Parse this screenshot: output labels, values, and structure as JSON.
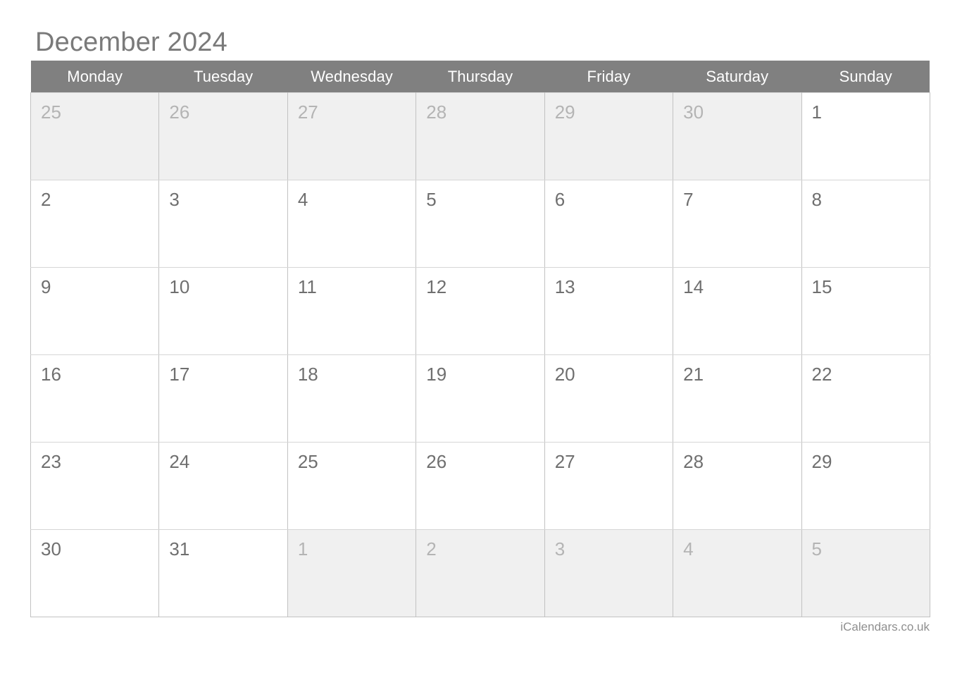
{
  "calendar": {
    "title": "December 2024",
    "month_name": "December",
    "year": "2024",
    "weekday_headers": [
      "Monday",
      "Tuesday",
      "Wednesday",
      "Thursday",
      "Friday",
      "Saturday",
      "Sunday"
    ],
    "weeks": [
      [
        {
          "day": "25",
          "in_month": false
        },
        {
          "day": "26",
          "in_month": false
        },
        {
          "day": "27",
          "in_month": false
        },
        {
          "day": "28",
          "in_month": false
        },
        {
          "day": "29",
          "in_month": false
        },
        {
          "day": "30",
          "in_month": false
        },
        {
          "day": "1",
          "in_month": true
        }
      ],
      [
        {
          "day": "2",
          "in_month": true
        },
        {
          "day": "3",
          "in_month": true
        },
        {
          "day": "4",
          "in_month": true
        },
        {
          "day": "5",
          "in_month": true
        },
        {
          "day": "6",
          "in_month": true
        },
        {
          "day": "7",
          "in_month": true
        },
        {
          "day": "8",
          "in_month": true
        }
      ],
      [
        {
          "day": "9",
          "in_month": true
        },
        {
          "day": "10",
          "in_month": true
        },
        {
          "day": "11",
          "in_month": true
        },
        {
          "day": "12",
          "in_month": true
        },
        {
          "day": "13",
          "in_month": true
        },
        {
          "day": "14",
          "in_month": true
        },
        {
          "day": "15",
          "in_month": true
        }
      ],
      [
        {
          "day": "16",
          "in_month": true
        },
        {
          "day": "17",
          "in_month": true
        },
        {
          "day": "18",
          "in_month": true
        },
        {
          "day": "19",
          "in_month": true
        },
        {
          "day": "20",
          "in_month": true
        },
        {
          "day": "21",
          "in_month": true
        },
        {
          "day": "22",
          "in_month": true
        }
      ],
      [
        {
          "day": "23",
          "in_month": true
        },
        {
          "day": "24",
          "in_month": true
        },
        {
          "day": "25",
          "in_month": true
        },
        {
          "day": "26",
          "in_month": true
        },
        {
          "day": "27",
          "in_month": true
        },
        {
          "day": "28",
          "in_month": true
        },
        {
          "day": "29",
          "in_month": true
        }
      ],
      [
        {
          "day": "30",
          "in_month": true
        },
        {
          "day": "31",
          "in_month": true
        },
        {
          "day": "1",
          "in_month": false
        },
        {
          "day": "2",
          "in_month": false
        },
        {
          "day": "3",
          "in_month": false
        },
        {
          "day": "4",
          "in_month": false
        },
        {
          "day": "5",
          "in_month": false
        }
      ]
    ]
  },
  "footer": {
    "credit": "iCalendars.co.uk"
  },
  "colors": {
    "header_background": "#808080",
    "header_text": "#ffffff",
    "title_text": "#7a7a7a",
    "in_month_day_text": "#6f6f6f",
    "other_month_day_text": "#b4b4b4",
    "other_month_cell_background": "#f0f0f0",
    "cell_background": "#ffffff",
    "grid_border": "#c2c2c2",
    "footer_text": "#8f8f8f"
  }
}
